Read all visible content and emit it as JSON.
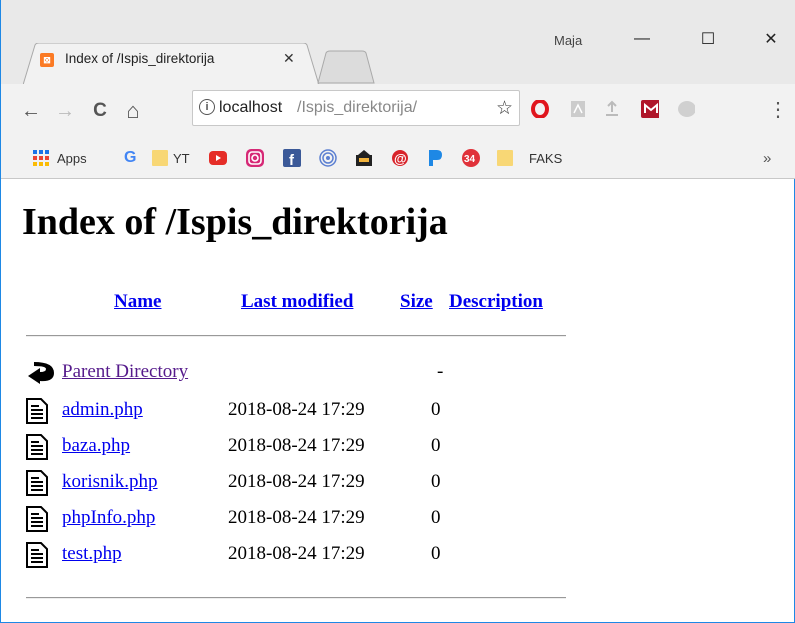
{
  "window": {
    "user": "Maja",
    "minimize": "—",
    "maximize": "☐",
    "close": "✕"
  },
  "tab": {
    "title": "Index of /Ispis_direktorija",
    "close": "✕",
    "favicon": "xampp-icon"
  },
  "toolbar": {
    "back": "←",
    "forward": "→",
    "reload": "C",
    "home": "⌂",
    "url_host": "localhost",
    "url_path": "/Ispis_direktorija/",
    "info": "i",
    "star": "☆",
    "menu": "⋮"
  },
  "bookmarks": [
    {
      "label": "Apps",
      "icon": "apps-grid-icon"
    },
    {
      "label": "",
      "icon": "google-icon",
      "glyph": "G",
      "color": "#4285f4"
    },
    {
      "label": "",
      "icon": "folder-icon"
    },
    {
      "label": "YT",
      "icon": "text"
    },
    {
      "label": "",
      "icon": "youtube-icon",
      "color": "#e52d27"
    },
    {
      "label": "",
      "icon": "instagram-icon",
      "color": "#d62976"
    },
    {
      "label": "",
      "icon": "facebook-icon",
      "color": "#3b5998"
    },
    {
      "label": "",
      "icon": "target-icon",
      "color": "#5b7fd1"
    },
    {
      "label": "",
      "icon": "shop-icon",
      "color": "#222"
    },
    {
      "label": "",
      "icon": "at-icon",
      "color": "#d8232a"
    },
    {
      "label": "",
      "icon": "p-icon",
      "color": "#1e88e5"
    },
    {
      "label": "34",
      "icon": "badge-34-icon",
      "color": "#e0323a"
    },
    {
      "label": "",
      "icon": "folder-icon"
    },
    {
      "label": "FAKS",
      "icon": "text"
    }
  ],
  "bookmarks_overflow": "»",
  "page": {
    "heading": "Index of /Ispis_direktorija",
    "columns": [
      "Name",
      "Last modified",
      "Size",
      "Description"
    ],
    "parent": {
      "name": "Parent Directory",
      "size": "-"
    },
    "files": [
      {
        "name": "admin.php",
        "modified": "2018-08-24 17:29",
        "size": "0"
      },
      {
        "name": "baza.php",
        "modified": "2018-08-24 17:29",
        "size": "0"
      },
      {
        "name": "korisnik.php",
        "modified": "2018-08-24 17:29",
        "size": "0"
      },
      {
        "name": "phpInfo.php",
        "modified": "2018-08-24 17:29",
        "size": "0"
      },
      {
        "name": "test.php",
        "modified": "2018-08-24 17:29",
        "size": "0"
      }
    ]
  }
}
